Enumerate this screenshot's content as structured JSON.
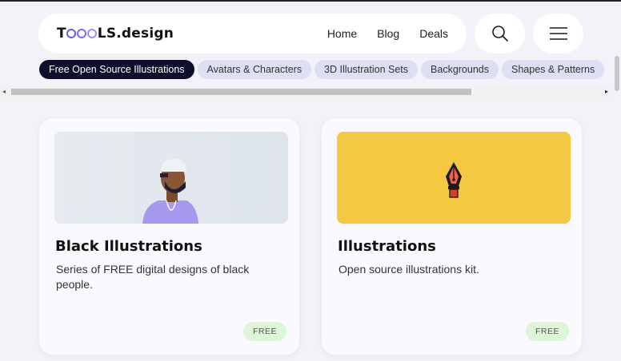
{
  "header": {
    "logo_text_prefix": "T",
    "logo_text_suffix": "LS.design",
    "nav": [
      "Home",
      "Blog",
      "Deals"
    ],
    "search_icon": "search-icon",
    "menu_icon": "hamburger-menu-icon"
  },
  "categories": [
    "Free Open Source Illustrations",
    "Avatars & Characters",
    "3D Illustration Sets",
    "Backgrounds",
    "Shapes & Patterns"
  ],
  "active_category": 0,
  "cards": [
    {
      "title": "Black Illustrations",
      "description": "Series of FREE digital designs of black people.",
      "badge": "FREE",
      "thumb_bg": "#e3e9ee"
    },
    {
      "title": "Illustrations",
      "description": "Open source illustrations kit.",
      "badge": "FREE",
      "thumb_bg": "#f5c842"
    }
  ],
  "colors": {
    "page_bg": "#f2f2f8",
    "active_pill": "#0e0f2c",
    "pill": "#dddff4",
    "badge_bg": "#dff5d8"
  }
}
